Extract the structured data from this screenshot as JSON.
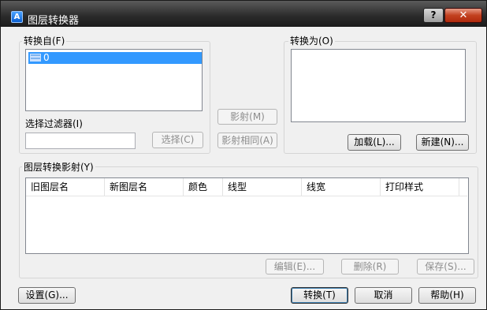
{
  "window": {
    "title": "图层转换器",
    "help_label": "?",
    "close_label": "✕"
  },
  "convert_from": {
    "label": "转换自(F)",
    "items": [
      "0"
    ],
    "filter_label": "选择过滤器(I)",
    "filter_value": "",
    "select_button": "选择(C)"
  },
  "middle": {
    "map_button": "影射(M)",
    "map_same_button": "影射相同(A)"
  },
  "convert_to": {
    "label": "转换为(O)",
    "load_button": "加载(L)...",
    "new_button": "新建(N)..."
  },
  "mappings": {
    "label": "图层转换影射(Y)",
    "columns": [
      "旧图层名",
      "新图层名",
      "颜色",
      "线型",
      "线宽",
      "打印样式"
    ],
    "rows": [],
    "edit_button": "编辑(E)...",
    "delete_button": "删除(R)",
    "save_button": "保存(S)..."
  },
  "footer": {
    "settings_button": "设置(G)...",
    "convert_button": "转换(T)",
    "cancel_button": "取消",
    "help_button": "帮助(H)"
  },
  "icons": {
    "app": "autocad-icon",
    "layer": "layer-icon"
  }
}
